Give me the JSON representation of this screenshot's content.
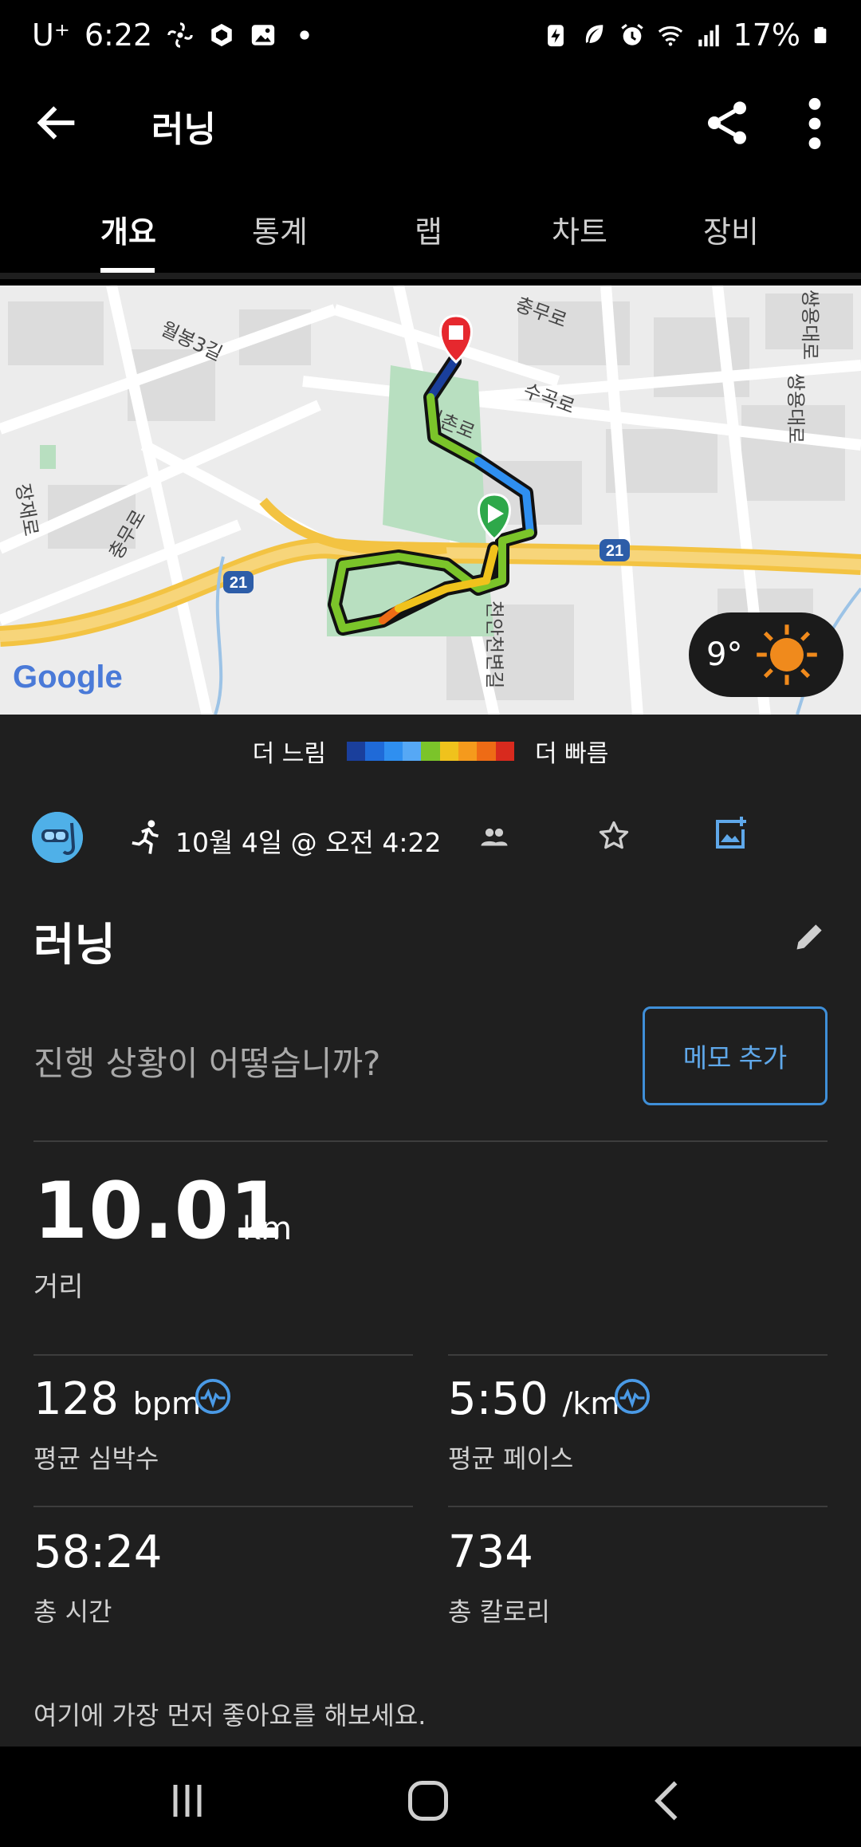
{
  "status_bar": {
    "carrier": "U⁺",
    "time": "6:22",
    "battery": "17%"
  },
  "app_bar": {
    "title": "러닝"
  },
  "tabs": [
    {
      "label": "개요",
      "active": true
    },
    {
      "label": "통계",
      "active": false
    },
    {
      "label": "랩",
      "active": false
    },
    {
      "label": "차트",
      "active": false
    },
    {
      "label": "장비",
      "active": false
    }
  ],
  "map": {
    "labels": [
      "월봉3길",
      "충무로",
      "수곡로",
      "신촌로",
      "장재로",
      "충무로",
      "천안천변길",
      "쌍용대로",
      "쌍용대로",
      "21",
      "21"
    ],
    "attribution": "Google",
    "weather": {
      "temp": "9°",
      "icon": "sun-icon"
    }
  },
  "pace_legend": {
    "slower": "더 느림",
    "faster": "더 빠름",
    "colors": [
      "#1a3f9c",
      "#1f6ad8",
      "#2f8ff0",
      "#56a8f5",
      "#7bc42a",
      "#f0c21c",
      "#f59a1c",
      "#ee6b15",
      "#d82a1e"
    ]
  },
  "activity": {
    "date": "10월 4일 @ 오전 4:22",
    "name": "러닝",
    "note_prompt": "진행 상황이 어떻습니까?",
    "memo_button": "메모 추가"
  },
  "stats": {
    "distance": {
      "value": "10.01",
      "unit": "km",
      "label": "거리"
    },
    "avg_hr": {
      "value": "128",
      "unit": "bpm",
      "label": "평균 심박수"
    },
    "avg_pace": {
      "value": "5:50",
      "unit": "/km",
      "label": "평균 페이스"
    },
    "total_time": {
      "value": "58:24",
      "label": "총 시간"
    },
    "calories": {
      "value": "734",
      "label": "총 칼로리"
    }
  },
  "likes_prompt": "여기에 가장 먼저 좋아요를 해보세요.",
  "colors": {
    "accent": "#3f8fd8",
    "background": "#1f1f1f",
    "start_marker": "#2ea84a",
    "end_marker": "#e6282e"
  }
}
